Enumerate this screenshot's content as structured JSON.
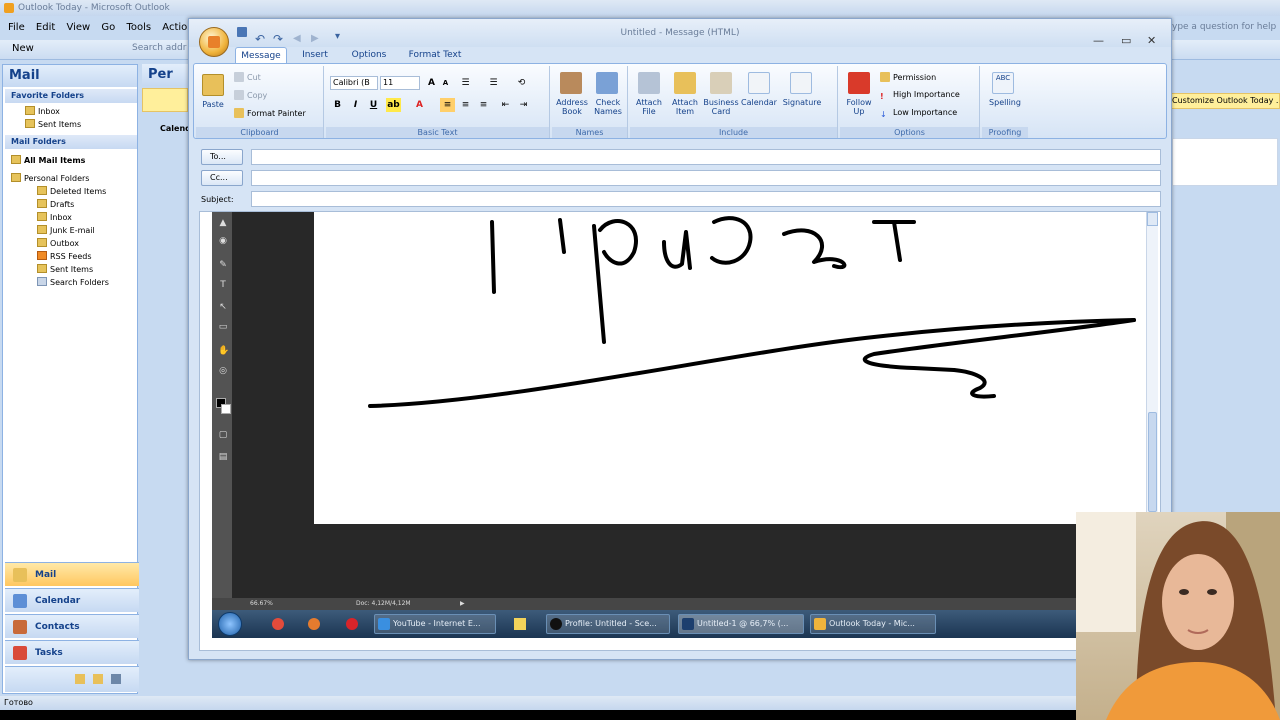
{
  "outlook": {
    "title": "Outlook Today - Microsoft Outlook",
    "menu": [
      "File",
      "Edit",
      "View",
      "Go",
      "Tools",
      "Actio"
    ],
    "new_label": "New",
    "search_placeholder": "Search addr",
    "help_placeholder": "ype a question for help",
    "content_head": "Per",
    "calendar_label": "Calend",
    "customize_link": "Customize Outlook Today ...",
    "status_text": "Готово"
  },
  "nav": {
    "header": "Mail",
    "favorites_header": "Favorite Folders",
    "favorites": [
      "Inbox",
      "Sent Items"
    ],
    "mail_folders_header": "Mail Folders",
    "all_mail_items": "All Mail Items",
    "personal_folders": "Personal Folders",
    "folders": [
      "Deleted Items",
      "Drafts",
      "Inbox",
      "Junk E-mail",
      "Outbox",
      "RSS Feeds",
      "Sent Items",
      "Search Folders"
    ],
    "buttons": [
      "Mail",
      "Calendar",
      "Contacts",
      "Tasks"
    ]
  },
  "message": {
    "title": "Untitled - Message (HTML)",
    "tabs": [
      "Message",
      "Insert",
      "Options",
      "Format Text"
    ],
    "clipboard": {
      "paste": "Paste",
      "cut": "Cut",
      "copy": "Copy",
      "format_painter": "Format Painter",
      "label": "Clipboard"
    },
    "basic_text": {
      "font": "Calibri (B",
      "size": "11",
      "label": "Basic Text"
    },
    "names": {
      "address_book": "Address\nBook",
      "check_names": "Check\nNames",
      "label": "Names"
    },
    "include": {
      "attach_file": "Attach\nFile",
      "attach_item": "Attach\nItem",
      "business_card": "Business\nCard",
      "calendar": "Calendar",
      "signature": "Signature",
      "label": "Include"
    },
    "options": {
      "follow_up": "Follow\nUp",
      "permission": "Permission",
      "high": "High Importance",
      "low": "Low Importance",
      "label": "Options"
    },
    "proofing": {
      "spelling": "Spelling",
      "label": "Proofing"
    },
    "to_label": "To...",
    "cc_label": "Cc...",
    "subject_label": "Subject:"
  },
  "photoshop": {
    "zoom": "66.67%",
    "doc": "Doc: 4,12M/4,12M",
    "taskbar": [
      "YouTube - Internet E...",
      "Profile: Untitled - Sce...",
      "Untitled-1 @ 66,7% (...",
      "Outlook Today - Mic..."
    ]
  }
}
